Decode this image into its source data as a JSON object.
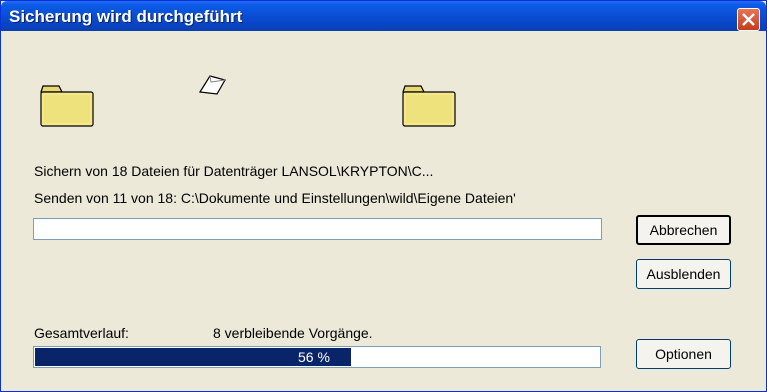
{
  "window": {
    "title": "Sicherung wird durchgeführt"
  },
  "status": {
    "line1": "Sichern von 18 Dateien für Datenträger LANSOL\\KRYPTON\\C...",
    "line2": "Senden von 11 von 18: C:\\Dokumente und Einstellungen\\wild\\Eigene Dateien'"
  },
  "file_progress": {
    "fraction": 0.0
  },
  "total": {
    "label": "Gesamtverlauf:",
    "remaining": "8 verbleibende Vorgänge.",
    "percent_text": "56 %",
    "fraction": 0.56
  },
  "buttons": {
    "cancel": "Abbrechen",
    "hide": "Ausblenden",
    "options": "Optionen"
  },
  "icons": {
    "source": "folder-icon",
    "flying": "document-icon",
    "target": "folder-icon",
    "close": "close-icon"
  },
  "colors": {
    "titlebar": "#0a4fd6",
    "progress_fill": "#0a246a",
    "close_button": "#d6502f"
  }
}
